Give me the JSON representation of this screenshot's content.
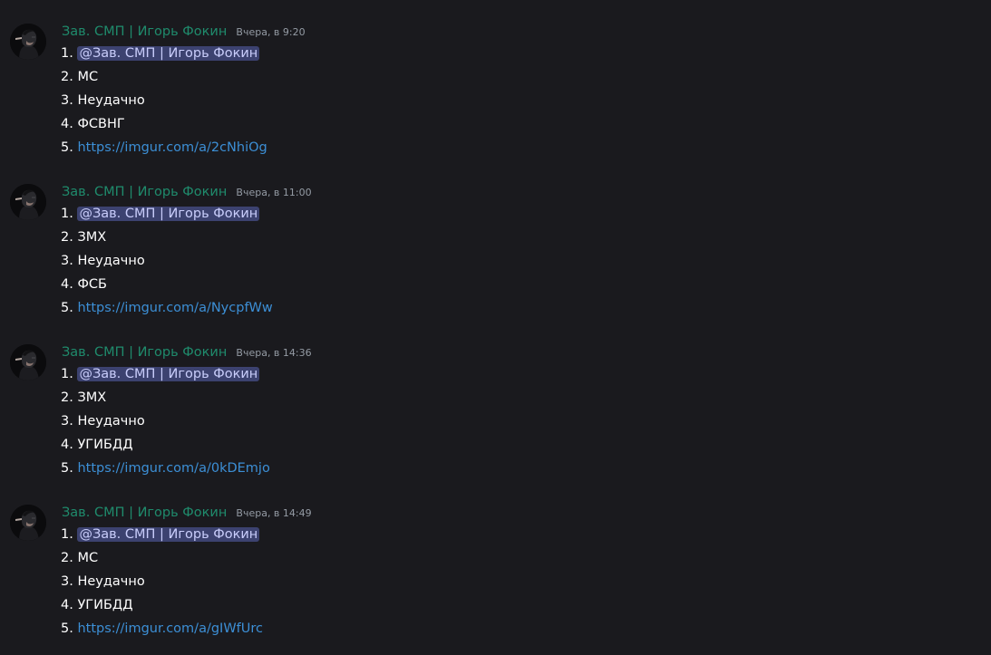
{
  "colors": {
    "background": "#1a1a1e",
    "username": "#1f8b6c",
    "timestamp": "#949ba4",
    "mention_bg": "#3c4270",
    "mention_text": "#c9cdfb",
    "link": "#3c8fd6",
    "text": "#ffffff"
  },
  "messages": [
    {
      "author": "Зав. СМП | Игорь Фокин",
      "timestamp": "Вчера, в 9:20",
      "avatar_icon": "user-avatar",
      "lines": [
        {
          "num": "1.",
          "text": "@Зав. СМП | Игорь Фокин"
        },
        {
          "num": "2.",
          "text": "МС"
        },
        {
          "num": "3.",
          "text": "Неудачно"
        },
        {
          "num": "4.",
          "text": "ФСВНГ"
        },
        {
          "num": "5.",
          "text": "https://imgur.com/a/2cNhiOg"
        }
      ]
    },
    {
      "author": "Зав. СМП | Игорь Фокин",
      "timestamp": "Вчера, в 11:00",
      "avatar_icon": "user-avatar",
      "lines": [
        {
          "num": "1.",
          "text": "@Зав. СМП | Игорь Фокин"
        },
        {
          "num": "2.",
          "text": "ЗМХ"
        },
        {
          "num": "3.",
          "text": "Неудачно"
        },
        {
          "num": "4.",
          "text": "ФСБ"
        },
        {
          "num": "5.",
          "text": "https://imgur.com/a/NycpfWw"
        }
      ]
    },
    {
      "author": "Зав. СМП | Игорь Фокин",
      "timestamp": "Вчера, в 14:36",
      "avatar_icon": "user-avatar",
      "lines": [
        {
          "num": "1.",
          "text": "@Зав. СМП | Игорь Фокин"
        },
        {
          "num": "2.",
          "text": "ЗМХ"
        },
        {
          "num": "3.",
          "text": "Неудачно"
        },
        {
          "num": "4.",
          "text": "УГИБДД"
        },
        {
          "num": "5.",
          "text": "https://imgur.com/a/0kDEmjo"
        }
      ]
    },
    {
      "author": "Зав. СМП | Игорь Фокин",
      "timestamp": "Вчера, в 14:49",
      "avatar_icon": "user-avatar",
      "lines": [
        {
          "num": "1.",
          "text": "@Зав. СМП | Игорь Фокин"
        },
        {
          "num": "2.",
          "text": "МС"
        },
        {
          "num": "3.",
          "text": "Неудачно"
        },
        {
          "num": "4.",
          "text": "УГИБДД"
        },
        {
          "num": "5.",
          "text": "https://imgur.com/a/gIWfUrc"
        }
      ]
    }
  ]
}
